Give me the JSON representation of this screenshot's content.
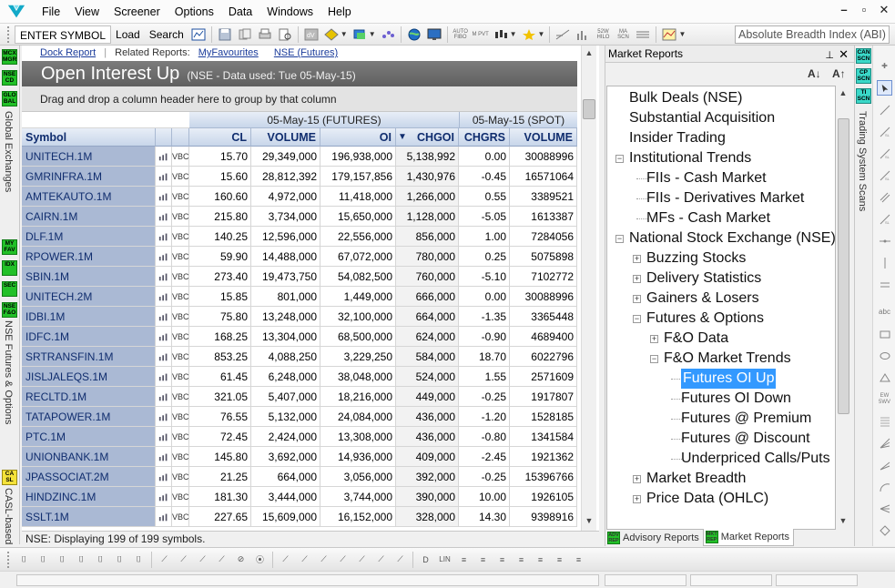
{
  "menu": {
    "items": [
      "File",
      "View",
      "Screener",
      "Options",
      "Data",
      "Windows",
      "Help"
    ],
    "window_controls": [
      "–",
      "▫",
      "✕"
    ]
  },
  "toolbar": {
    "enter_symbol": "ENTER SYMBOL",
    "load": "Load",
    "search": "Search",
    "small_icon_labels": [
      "AUTO FIBO",
      "M PVT",
      "52W HILO",
      "MA SCN"
    ],
    "indicator_select": "Absolute Breadth Index (ABI)"
  },
  "left_strip": {
    "badges": [
      "MCX MGR",
      "NSE CD",
      "GLO BAL",
      "MY FAV",
      "IDX",
      "SEC",
      "NSE F&O",
      "CA SL"
    ],
    "labels": [
      "Global Exchanges",
      "NSE Futures & Options",
      "CASL-based"
    ]
  },
  "report": {
    "related_prefix": "Dock Report",
    "related_label": "Related Reports:",
    "related_links": [
      "MyFavourites",
      "NSE (Futures)"
    ],
    "title": "Open Interest Up",
    "subtitle": "(NSE - Data used: Tue 05-May-15)",
    "group_hint": "Drag and drop a column header here to group by that column",
    "group_headers": {
      "futures": "05-May-15 (FUTURES)",
      "spot": "05-May-15 (SPOT)"
    },
    "columns": [
      "Symbol",
      "CL",
      "VOLUME",
      "OI",
      "CHGOI",
      "CHGRS",
      "VOLUME"
    ],
    "sort_indicator": "▼",
    "row_icon_labels": [
      "VBC"
    ],
    "rows": [
      [
        "UNITECH.1M",
        "15.70",
        "29,349,000",
        "196,938,000",
        "5,138,992",
        "0.00",
        "30088996"
      ],
      [
        "GMRINFRA.1M",
        "15.60",
        "28,812,392",
        "179,157,856",
        "1,430,976",
        "-0.45",
        "16571064"
      ],
      [
        "AMTEKAUTO.1M",
        "160.60",
        "4,972,000",
        "11,418,000",
        "1,266,000",
        "0.55",
        "3389521"
      ],
      [
        "CAIRN.1M",
        "215.80",
        "3,734,000",
        "15,650,000",
        "1,128,000",
        "-5.05",
        "1613387"
      ],
      [
        "DLF.1M",
        "140.25",
        "12,596,000",
        "22,556,000",
        "856,000",
        "1.00",
        "7284056"
      ],
      [
        "RPOWER.1M",
        "59.90",
        "14,488,000",
        "67,072,000",
        "780,000",
        "0.25",
        "5075898"
      ],
      [
        "SBIN.1M",
        "273.40",
        "19,473,750",
        "54,082,500",
        "760,000",
        "-5.10",
        "7102772"
      ],
      [
        "UNITECH.2M",
        "15.85",
        "801,000",
        "1,449,000",
        "666,000",
        "0.00",
        "30088996"
      ],
      [
        "IDBI.1M",
        "75.80",
        "13,248,000",
        "32,100,000",
        "664,000",
        "-1.35",
        "3365448"
      ],
      [
        "IDFC.1M",
        "168.25",
        "13,304,000",
        "68,500,000",
        "624,000",
        "-0.90",
        "4689400"
      ],
      [
        "SRTRANSFIN.1M",
        "853.25",
        "4,088,250",
        "3,229,250",
        "584,000",
        "18.70",
        "6022796"
      ],
      [
        "JISLJALEQS.1M",
        "61.45",
        "6,248,000",
        "38,048,000",
        "524,000",
        "1.55",
        "2571609"
      ],
      [
        "RECLTD.1M",
        "321.05",
        "5,407,000",
        "18,216,000",
        "449,000",
        "-0.25",
        "1917807"
      ],
      [
        "TATAPOWER.1M",
        "76.55",
        "5,132,000",
        "24,084,000",
        "436,000",
        "-1.20",
        "1528185"
      ],
      [
        "PTC.1M",
        "72.45",
        "2,424,000",
        "13,308,000",
        "436,000",
        "-0.80",
        "1341584"
      ],
      [
        "UNIONBANK.1M",
        "145.80",
        "3,692,000",
        "14,936,000",
        "409,000",
        "-2.45",
        "1921362"
      ],
      [
        "JPASSOCIAT.2M",
        "21.25",
        "664,000",
        "3,056,000",
        "392,000",
        "-0.25",
        "15396766"
      ],
      [
        "HINDZINC.1M",
        "181.30",
        "3,444,000",
        "3,744,000",
        "390,000",
        "10.00",
        "1926105"
      ],
      [
        "SSLT.1M",
        "227.65",
        "15,609,000",
        "16,152,000",
        "328,000",
        "14.30",
        "9398916"
      ]
    ],
    "status": "NSE: Displaying 199 of 199 symbols."
  },
  "market_reports": {
    "header": "Market Reports",
    "pin_icon": "pin-icon",
    "font_buttons": [
      "A↓",
      "A↑"
    ],
    "tree": [
      {
        "label": "Bulk Deals (NSE)",
        "level": 0,
        "expander": "none"
      },
      {
        "label": "Substantial Acquisition",
        "level": 0,
        "expander": "none"
      },
      {
        "label": "Insider Trading",
        "level": 0,
        "expander": "none"
      },
      {
        "label": "Institutional Trends",
        "level": 0,
        "expander": "minus"
      },
      {
        "label": "FIIs - Cash Market",
        "level": 1,
        "expander": "none"
      },
      {
        "label": "FIIs - Derivatives Market",
        "level": 1,
        "expander": "none"
      },
      {
        "label": "MFs - Cash Market",
        "level": 1,
        "expander": "none"
      },
      {
        "label": "National Stock Exchange (NSE)",
        "level": 0,
        "expander": "minus"
      },
      {
        "label": "Buzzing Stocks",
        "level": 1,
        "expander": "plus"
      },
      {
        "label": "Delivery Statistics",
        "level": 1,
        "expander": "plus"
      },
      {
        "label": "Gainers & Losers",
        "level": 1,
        "expander": "plus"
      },
      {
        "label": "Futures & Options",
        "level": 1,
        "expander": "minus"
      },
      {
        "label": "F&O Data",
        "level": 2,
        "expander": "plus"
      },
      {
        "label": "F&O Market Trends",
        "level": 2,
        "expander": "minus"
      },
      {
        "label": "Futures OI Up",
        "level": 3,
        "expander": "none",
        "selected": true
      },
      {
        "label": "Futures OI Down",
        "level": 3,
        "expander": "none"
      },
      {
        "label": "Futures @ Premium",
        "level": 3,
        "expander": "none"
      },
      {
        "label": "Futures @ Discount",
        "level": 3,
        "expander": "none"
      },
      {
        "label": "Underpriced Calls/Puts",
        "level": 3,
        "expander": "none"
      },
      {
        "label": "Market Breadth",
        "level": 1,
        "expander": "plus"
      },
      {
        "label": "Price Data (OHLC)",
        "level": 1,
        "expander": "plus"
      }
    ],
    "tabs": [
      {
        "badge": "ADV REP",
        "label": "Advisory Reports"
      },
      {
        "badge": "MKT REP",
        "label": "Market Reports"
      }
    ]
  },
  "right_strip": {
    "badges": [
      "CAN SCN",
      "CP SCN",
      "TI SCN"
    ],
    "label": "Trading System Scans"
  },
  "draw_strip": {
    "text_icons": [
      "abc",
      "EW 5WV"
    ]
  },
  "bottom_toolbar": {
    "text_icons": [
      "LIN"
    ]
  },
  "colors": {
    "symbol_cell": "#aab9d4",
    "title_bar": "#6b6b6b",
    "selection": "#3399ff",
    "badge_green": "#22c028",
    "header_blue": "#c8d6ea"
  }
}
